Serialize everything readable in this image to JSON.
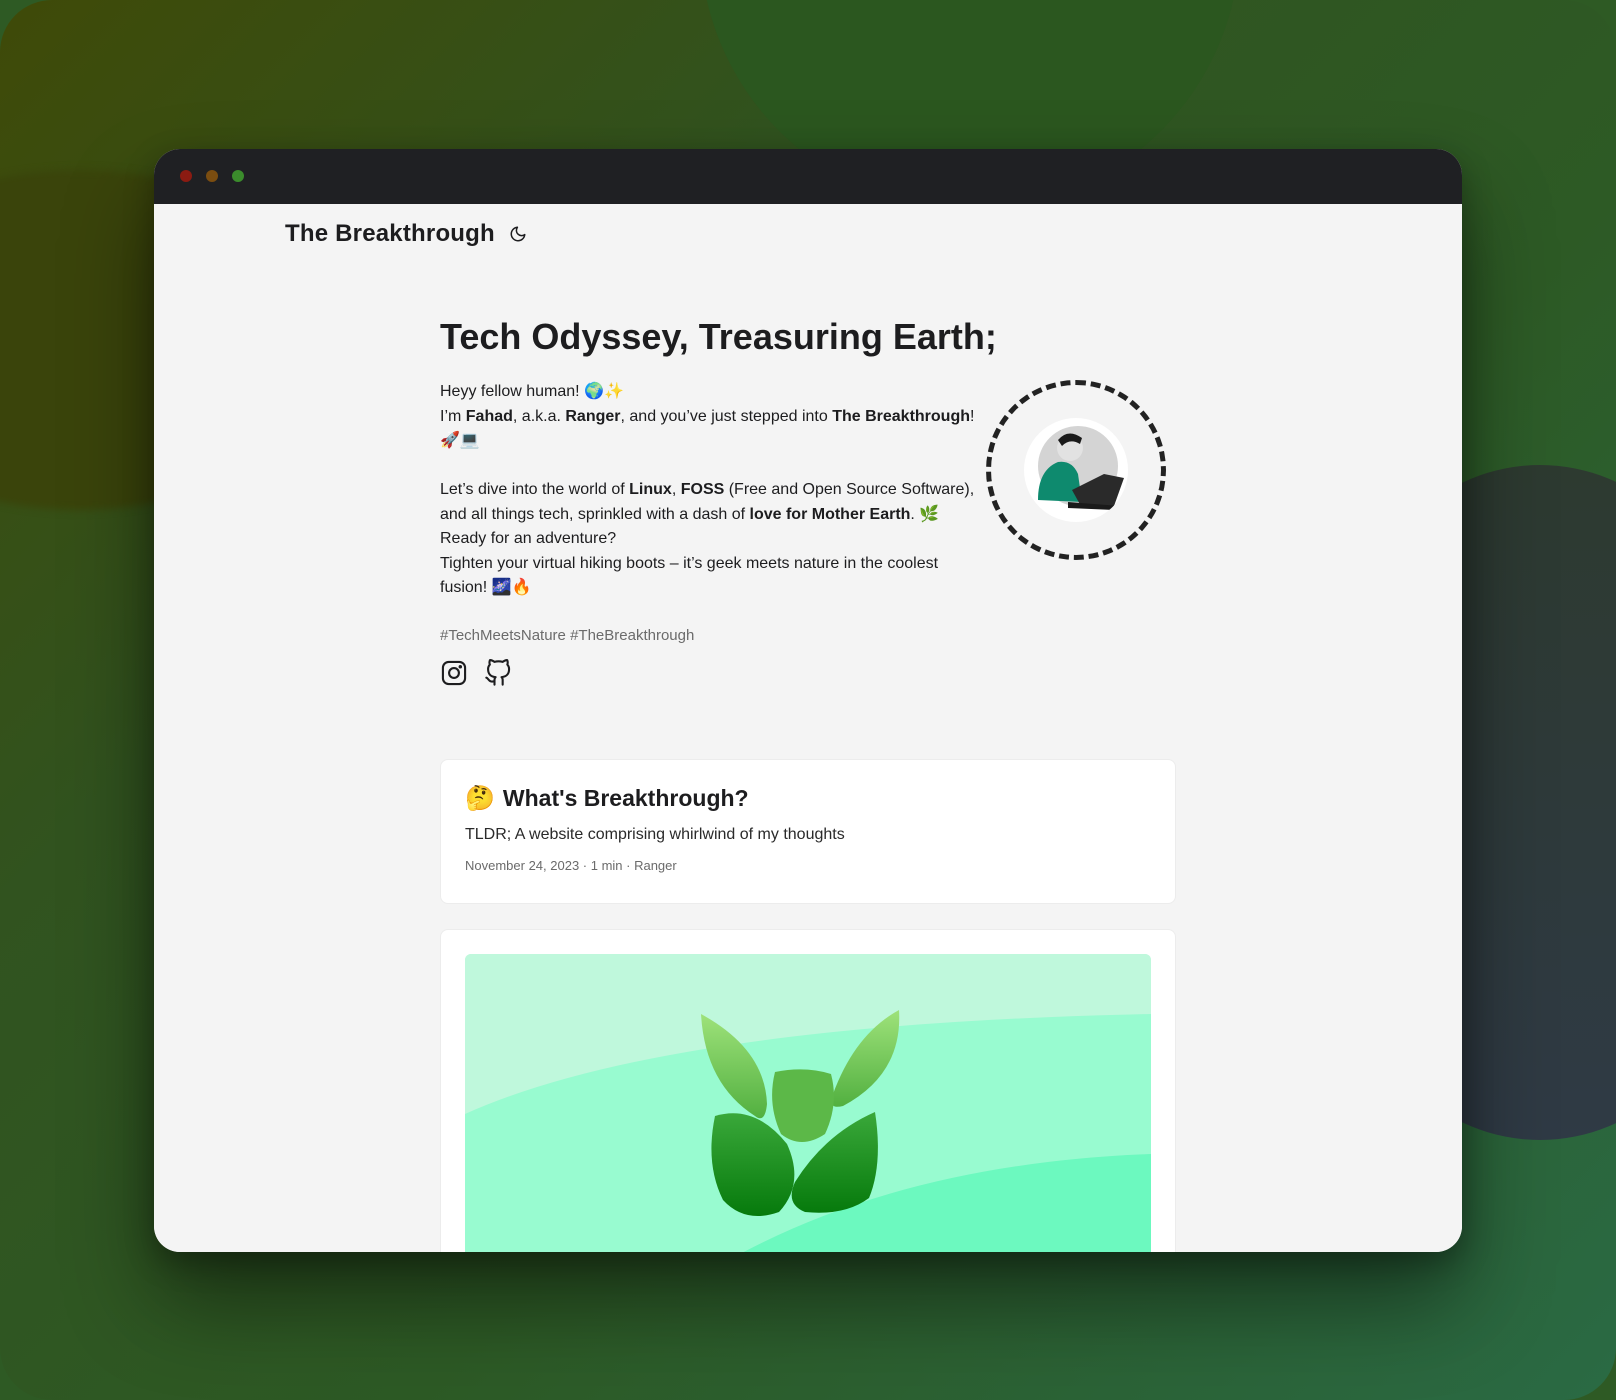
{
  "site": {
    "logo": "The Breakthrough",
    "theme_icon": "moon-icon"
  },
  "hero": {
    "title": "Tech Odyssey, Treasuring Earth;",
    "line1": "Heyy fellow human! 🌍✨",
    "line2_pre": "I’m ",
    "name": "Fahad",
    "line2_mid": ", a.k.a. ",
    "alias": "Ranger",
    "line2_post": ", and you’ve just stepped into ",
    "site_name": "The Breakthrough",
    "line2_end": "! 🚀💻",
    "p2_pre": "Let’s dive into the world of ",
    "linux": "Linux",
    "comma": ", ",
    "foss": "FOSS",
    "p2_mid": " (Free and Open Source Software), and all things tech, sprinkled with a dash of ",
    "love": "love for Mother Earth",
    "p2_end": ". 🌿",
    "p3": "Ready for an adventure?",
    "p4": "Tighten your virtual hiking boots – it’s geek meets nature in the coolest fusion! 🌌🔥",
    "hashtags": "#TechMeetsNature #TheBreakthrough"
  },
  "socials": [
    {
      "icon": "instagram-icon"
    },
    {
      "icon": "github-icon"
    }
  ],
  "post": {
    "emoji": "🤔",
    "title": "What's Breakthrough?",
    "description": "TLDR; A website comprising whirlwind of my thoughts",
    "meta": "November 24, 2023 · 1 min · Ranger"
  },
  "colors": {
    "titlebar": "#1f2023",
    "page_bg": "#f4f4f4",
    "accent_green": "#0a8a1e",
    "cover_bg": "#bff8dc"
  }
}
